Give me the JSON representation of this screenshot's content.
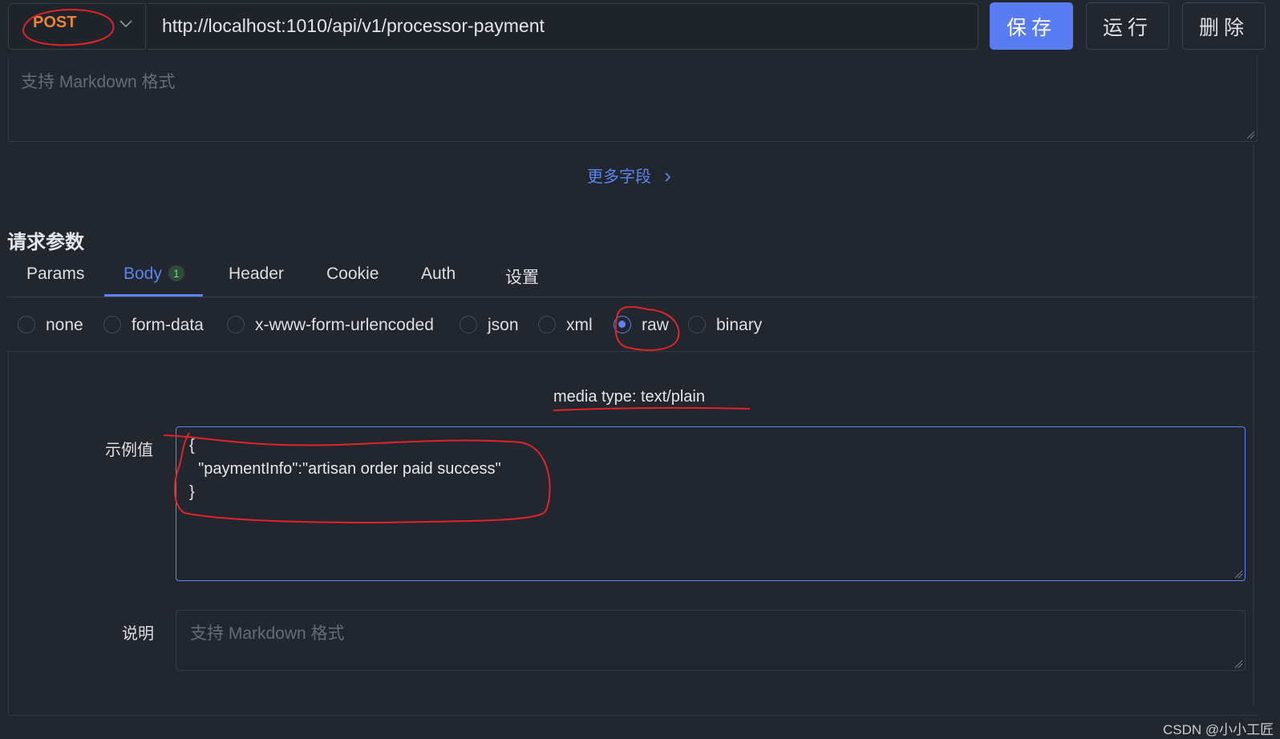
{
  "request": {
    "method": "POST",
    "url": "http://localhost:1010/api/v1/processor-payment"
  },
  "toolbar": {
    "save_label": "保存",
    "run_label": "运行",
    "delete_label": "删除"
  },
  "description": {
    "placeholder": "支持 Markdown 格式"
  },
  "more_fields_label": "更多字段",
  "params_section": {
    "title": "请求参数",
    "tabs": [
      {
        "label": "Params"
      },
      {
        "label": "Body",
        "badge": "1",
        "active": true
      },
      {
        "label": "Header"
      },
      {
        "label": "Cookie"
      },
      {
        "label": "Auth"
      },
      {
        "label": "设置"
      }
    ],
    "body_types": [
      {
        "label": "none",
        "selected": false
      },
      {
        "label": "form-data",
        "selected": false
      },
      {
        "label": "x-www-form-urlencoded",
        "selected": false
      },
      {
        "label": "json",
        "selected": false
      },
      {
        "label": "xml",
        "selected": false
      },
      {
        "label": "raw",
        "selected": true
      },
      {
        "label": "binary",
        "selected": false
      }
    ]
  },
  "body": {
    "media_type": "media type: text/plain",
    "example_label": "示例值",
    "example_lines": [
      "{",
      "  \"paymentInfo\":\"artisan order paid success\"",
      "}"
    ],
    "note_label": "说明",
    "note_placeholder": "支持 Markdown 格式"
  },
  "watermark": "CSDN @小小工匠",
  "colors": {
    "accent": "#5b84f0",
    "method": "#e8843a",
    "annotation": "#e0242c",
    "background": "#22262e"
  },
  "icons": [
    "chevron-down-icon",
    "chevron-right-icon",
    "resize-grip-icon"
  ]
}
